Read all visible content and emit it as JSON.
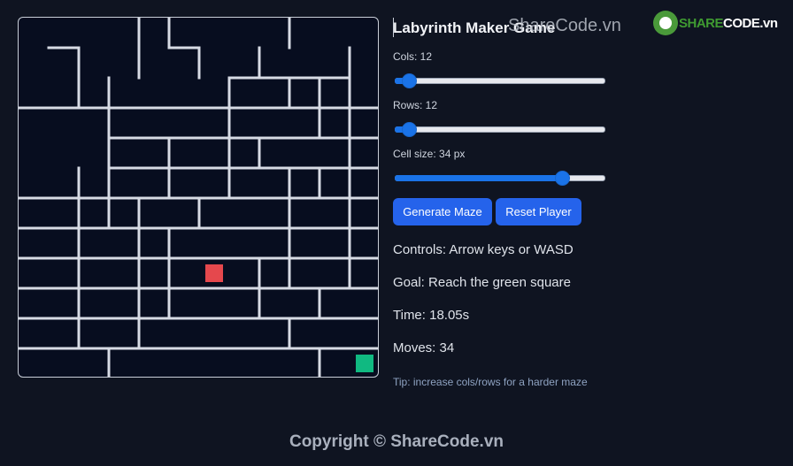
{
  "app": {
    "title": "Labyrinth Maker Game"
  },
  "controls": {
    "cols": {
      "label": "Cols: 12",
      "value": 12,
      "min": 5,
      "max": 60
    },
    "rows": {
      "label": "Rows: 12",
      "value": 12,
      "min": 5,
      "max": 60
    },
    "cell_size": {
      "label": "Cell size: 34 px",
      "value": 34,
      "min": 10,
      "max": 40
    },
    "generate_button": "Generate Maze",
    "reset_button": "Reset Player"
  },
  "info": {
    "controls_text": "Controls: Arrow keys or WASD",
    "goal_text": "Goal: Reach the green square",
    "time_text": "Time: 18.05s",
    "moves_text": "Moves: 34",
    "tip_text": "Tip: increase cols/rows for a harder maze"
  },
  "footer": {
    "copyright": "Copyright © ShareCode.vn"
  },
  "watermark": {
    "text": "ShareCode.vn",
    "logo_text_part1": "SHARE",
    "logo_text_part2": "CODE.vn"
  },
  "colors": {
    "background": "#0f1421",
    "maze_background": "#070d1f",
    "wall": "#d7dbe4",
    "player": "#e5484d",
    "goal": "#10b981",
    "accent": "#2563eb"
  },
  "maze": {
    "cols": 12,
    "rows": 12,
    "player_cell": [
      6,
      8
    ],
    "goal_cell": [
      11,
      11
    ],
    "h_walls": [
      [
        1,
        0
      ],
      [
        5,
        0
      ],
      [
        7,
        1
      ],
      [
        8,
        1
      ],
      [
        9,
        1
      ],
      [
        10,
        1
      ],
      [
        0,
        2
      ],
      [
        1,
        2
      ],
      [
        2,
        2
      ],
      [
        3,
        2
      ],
      [
        4,
        2
      ],
      [
        5,
        2
      ],
      [
        6,
        2
      ],
      [
        7,
        2
      ],
      [
        8,
        2
      ],
      [
        9,
        2
      ],
      [
        10,
        2
      ],
      [
        11,
        2
      ],
      [
        3,
        3
      ],
      [
        4,
        3
      ],
      [
        5,
        3
      ],
      [
        6,
        3
      ],
      [
        7,
        3
      ],
      [
        8,
        3
      ],
      [
        9,
        3
      ],
      [
        10,
        3
      ],
      [
        11,
        3
      ],
      [
        3,
        4
      ],
      [
        4,
        4
      ],
      [
        5,
        4
      ],
      [
        6,
        4
      ],
      [
        7,
        4
      ],
      [
        8,
        4
      ],
      [
        9,
        4
      ],
      [
        10,
        4
      ],
      [
        11,
        4
      ],
      [
        0,
        5
      ],
      [
        1,
        5
      ],
      [
        2,
        5
      ],
      [
        3,
        5
      ],
      [
        4,
        5
      ],
      [
        5,
        5
      ],
      [
        6,
        5
      ],
      [
        7,
        5
      ],
      [
        8,
        5
      ],
      [
        9,
        5
      ],
      [
        10,
        5
      ],
      [
        11,
        5
      ],
      [
        0,
        6
      ],
      [
        1,
        6
      ],
      [
        2,
        6
      ],
      [
        3,
        6
      ],
      [
        4,
        6
      ],
      [
        5,
        6
      ],
      [
        6,
        6
      ],
      [
        7,
        6
      ],
      [
        8,
        6
      ],
      [
        9,
        6
      ],
      [
        10,
        6
      ],
      [
        11,
        6
      ],
      [
        0,
        7
      ],
      [
        1,
        7
      ],
      [
        2,
        7
      ],
      [
        3,
        7
      ],
      [
        4,
        7
      ],
      [
        5,
        7
      ],
      [
        6,
        7
      ],
      [
        7,
        7
      ],
      [
        8,
        7
      ],
      [
        9,
        7
      ],
      [
        10,
        7
      ],
      [
        11,
        7
      ],
      [
        0,
        8
      ],
      [
        1,
        8
      ],
      [
        2,
        8
      ],
      [
        3,
        8
      ],
      [
        4,
        8
      ],
      [
        5,
        8
      ],
      [
        6,
        8
      ],
      [
        7,
        8
      ],
      [
        8,
        8
      ],
      [
        9,
        8
      ],
      [
        10,
        8
      ],
      [
        11,
        8
      ],
      [
        0,
        9
      ],
      [
        1,
        9
      ],
      [
        2,
        9
      ],
      [
        3,
        9
      ],
      [
        4,
        9
      ],
      [
        5,
        9
      ],
      [
        6,
        9
      ],
      [
        7,
        9
      ],
      [
        8,
        9
      ],
      [
        9,
        9
      ],
      [
        10,
        9
      ],
      [
        11,
        9
      ],
      [
        0,
        10
      ],
      [
        1,
        10
      ],
      [
        2,
        10
      ],
      [
        3,
        10
      ],
      [
        4,
        10
      ],
      [
        5,
        10
      ],
      [
        6,
        10
      ],
      [
        7,
        10
      ],
      [
        8,
        10
      ],
      [
        9,
        10
      ],
      [
        10,
        10
      ],
      [
        11,
        10
      ],
      [
        0,
        11
      ],
      [
        1,
        11
      ],
      [
        2,
        11
      ],
      [
        3,
        11
      ],
      [
        4,
        11
      ],
      [
        5,
        11
      ],
      [
        6,
        11
      ],
      [
        7,
        11
      ],
      [
        8,
        11
      ],
      [
        9,
        11
      ],
      [
        10,
        11
      ],
      [
        11,
        11
      ]
    ],
    "v_walls": [
      [
        3,
        0
      ],
      [
        4,
        0
      ],
      [
        8,
        0
      ],
      [
        1,
        1
      ],
      [
        3,
        1
      ],
      [
        5,
        1
      ],
      [
        7,
        1
      ],
      [
        10,
        1
      ],
      [
        1,
        2
      ],
      [
        2,
        2
      ],
      [
        6,
        2
      ],
      [
        8,
        2
      ],
      [
        9,
        2
      ],
      [
        10,
        2
      ],
      [
        11,
        2
      ],
      [
        2,
        3
      ],
      [
        6,
        3
      ],
      [
        9,
        3
      ],
      [
        10,
        3
      ],
      [
        2,
        4
      ],
      [
        4,
        4
      ],
      [
        6,
        4
      ],
      [
        7,
        4
      ],
      [
        10,
        4
      ],
      [
        1,
        5
      ],
      [
        2,
        5
      ],
      [
        4,
        5
      ],
      [
        6,
        5
      ],
      [
        8,
        5
      ],
      [
        9,
        5
      ],
      [
        10,
        5
      ],
      [
        1,
        6
      ],
      [
        2,
        6
      ],
      [
        3,
        6
      ],
      [
        5,
        6
      ],
      [
        8,
        6
      ],
      [
        10,
        6
      ],
      [
        1,
        7
      ],
      [
        3,
        7
      ],
      [
        4,
        7
      ],
      [
        8,
        7
      ],
      [
        10,
        7
      ],
      [
        1,
        8
      ],
      [
        3,
        8
      ],
      [
        4,
        8
      ],
      [
        7,
        8
      ],
      [
        8,
        8
      ],
      [
        10,
        8
      ],
      [
        1,
        9
      ],
      [
        3,
        9
      ],
      [
        4,
        9
      ],
      [
        7,
        9
      ],
      [
        9,
        9
      ],
      [
        11,
        9
      ],
      [
        1,
        10
      ],
      [
        3,
        10
      ],
      [
        8,
        10
      ],
      [
        11,
        10
      ],
      [
        2,
        11
      ],
      [
        9,
        11
      ]
    ]
  }
}
